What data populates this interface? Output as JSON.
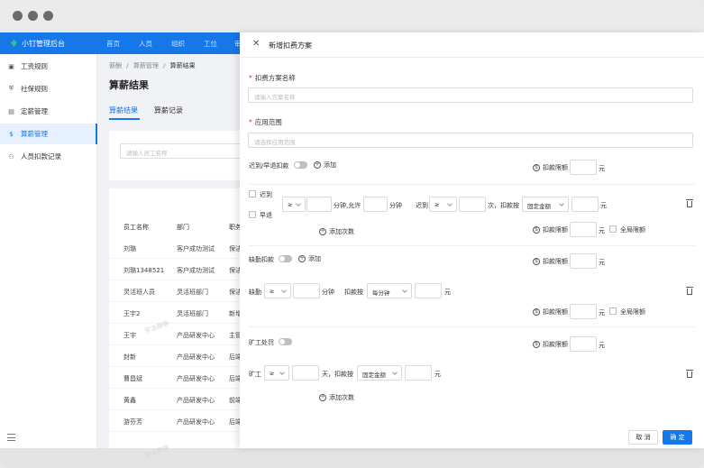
{
  "app": {
    "title": "小钉管理后台"
  },
  "topnav": [
    "首页",
    "人员",
    "组织",
    "工位",
    "审"
  ],
  "sidebar": {
    "items": [
      "工资规则",
      "社保规则",
      "定薪管理",
      "算薪管理",
      "人员扣款记录"
    ]
  },
  "main": {
    "breadcrumb": [
      "薪酬",
      "算薪管理",
      "算薪结果"
    ],
    "title": "算薪结果",
    "tabs": [
      "算薪结果",
      "算薪记录"
    ],
    "search_placeholder": "请输入员工名称",
    "columns": [
      "员工名称",
      "部门",
      "职务"
    ],
    "rows": [
      [
        "刘璐",
        "客户成功测试",
        "保洁"
      ],
      [
        "刘璐13485​21",
        "客户成功测试",
        "保洁"
      ],
      [
        "灵活班人员",
        "灵活班部门",
        "保洁"
      ],
      [
        "王宇2",
        "灵活班部门",
        "新增"
      ],
      [
        "王宇",
        "产品研发中心",
        "主管"
      ],
      [
        "封新",
        "产品研发中心",
        "后端"
      ],
      [
        "曹昌斌",
        "产品研发中心",
        "后端"
      ],
      [
        "黄鑫",
        "产品研发中心",
        "前端"
      ],
      [
        "游芬芳",
        "产品研发中心",
        "后端"
      ]
    ],
    "watermark": "宋洁静静"
  },
  "drawer": {
    "title": "新增扣费方案",
    "name_label": "扣费方案名称",
    "name_placeholder": "请输入方案名称",
    "scope_label": "应用范围",
    "scope_placeholder": "请选择应用范围",
    "late": {
      "label": "迟到/早退扣款",
      "add": "添加",
      "limit_label": "扣款限额",
      "unit": "元",
      "late_cb": "迟到",
      "early_cb": "早退",
      "op": "≥",
      "minutes_allow": "分钟,允许",
      "minutes": "分钟",
      "late_word": "迟到",
      "times_deduct": "次，扣款按",
      "mode": "固定金额",
      "add_times": "添加次数",
      "global_limit": "全局限额"
    },
    "absence": {
      "label": "缺勤扣款",
      "add": "添加",
      "limit_label": "扣款限额",
      "unit": "元",
      "absent_word": "缺勤",
      "op": "≥",
      "minutes": "分钟",
      "deduct_by": "扣款按",
      "mode": "每分钟",
      "global_limit": "全局限额"
    },
    "absent_work": {
      "label": "旷工处罚",
      "limit_label": "扣款限额",
      "unit": "元",
      "word": "旷工",
      "op": "≥",
      "days_deduct": "天，扣款按",
      "mode": "固定金额",
      "add_times": "添加次数"
    },
    "cancel": "取 消",
    "ok": "确 定"
  }
}
